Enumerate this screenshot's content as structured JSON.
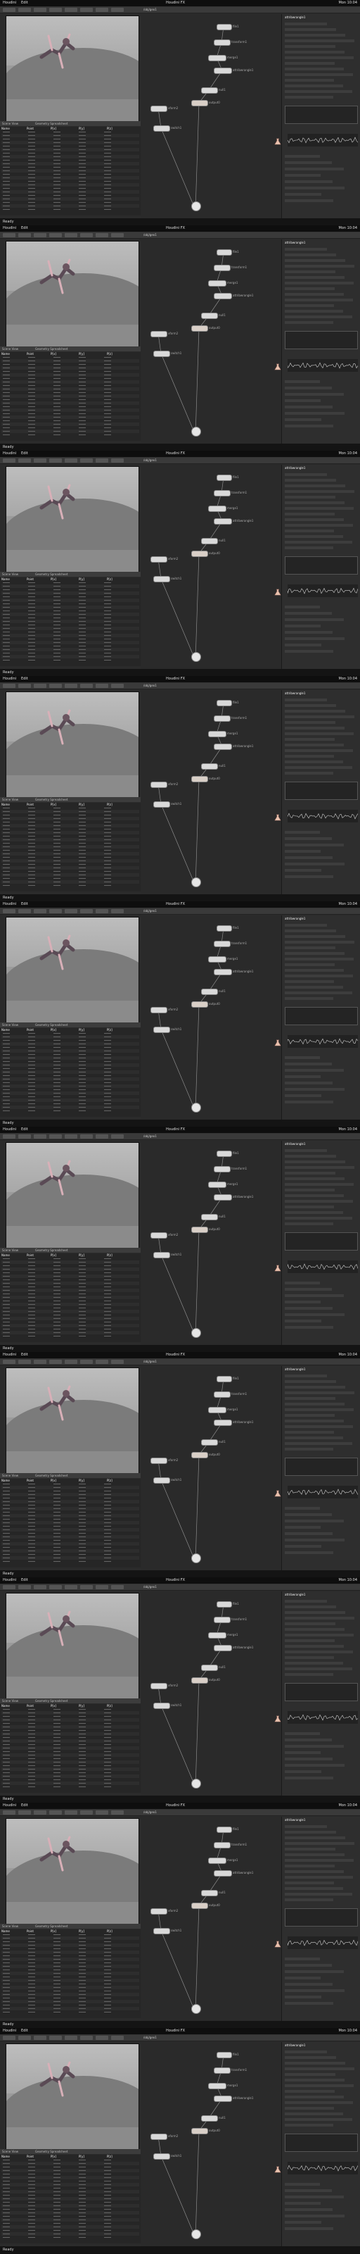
{
  "app": {
    "menu_left": [
      "Houdini",
      "Edit"
    ],
    "menu_center": "Houdini FX",
    "menu_right": "Mon 10:04",
    "graph_path": "/obj/geo1",
    "status_text": "Ready"
  },
  "viewer": {
    "tabs": [
      "Scene View",
      "Geometry Spreadsheet"
    ]
  },
  "table": {
    "columns": [
      "Name",
      "Point",
      "P[x]",
      "P[y]",
      "P[z]"
    ]
  },
  "graph": {
    "nodes": [
      "file1",
      "transform1",
      "merge1",
      "attribwrangle1",
      "null1",
      "output0",
      "xform2",
      "switch1"
    ]
  },
  "properties": {
    "title": "attribwrangle1"
  },
  "frames_count": 10,
  "colors": {
    "accent": "#e8c4b0",
    "node": "#d9d9d9",
    "panel": "#2b2b2b"
  }
}
